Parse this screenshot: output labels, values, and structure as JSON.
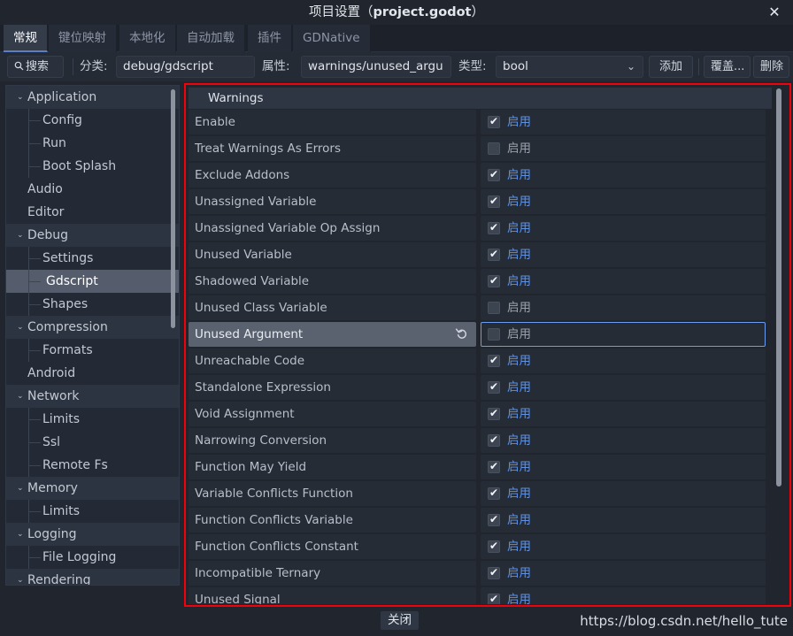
{
  "window": {
    "title_prefix": "项目设置（",
    "title_file": "project.godot",
    "title_suffix": "）",
    "close_icon": "✕"
  },
  "tabs": [
    {
      "label": "常规",
      "active": true
    },
    {
      "label": "键位映射",
      "active": false
    },
    {
      "label": "本地化",
      "active": false
    },
    {
      "label": "自动加载",
      "active": false
    },
    {
      "label": "插件",
      "active": false
    },
    {
      "label": "GDNative",
      "active": false
    }
  ],
  "toolbar": {
    "search_label": "搜索",
    "search_icon": "search-icon",
    "category_label": "分类:",
    "category_value": "debug/gdscript",
    "property_label": "属性:",
    "property_value": "warnings/unused_argu",
    "type_label": "类型:",
    "type_value": "bool",
    "type_chevron": "⌄",
    "add_label": "添加",
    "override_label": "覆盖...",
    "delete_label": "删除"
  },
  "sidebar": {
    "items": [
      {
        "label": "Application",
        "level": 0,
        "arrow": "⌄",
        "group": true,
        "selected": false,
        "guide": false
      },
      {
        "label": "Config",
        "level": 1,
        "arrow": "",
        "group": false,
        "selected": false,
        "guide": true
      },
      {
        "label": "Run",
        "level": 1,
        "arrow": "",
        "group": false,
        "selected": false,
        "guide": true
      },
      {
        "label": "Boot Splash",
        "level": 1,
        "arrow": "",
        "group": false,
        "selected": false,
        "guide": true
      },
      {
        "label": "Audio",
        "level": 0,
        "arrow": "",
        "group": false,
        "selected": false,
        "guide": false
      },
      {
        "label": "Editor",
        "level": 0,
        "arrow": "",
        "group": false,
        "selected": false,
        "guide": false
      },
      {
        "label": "Debug",
        "level": 0,
        "arrow": "⌄",
        "group": true,
        "selected": false,
        "guide": false
      },
      {
        "label": "Settings",
        "level": 1,
        "arrow": "",
        "group": false,
        "selected": false,
        "guide": true
      },
      {
        "label": "Gdscript",
        "level": 1,
        "arrow": "",
        "group": false,
        "selected": true,
        "guide": true
      },
      {
        "label": "Shapes",
        "level": 1,
        "arrow": "",
        "group": false,
        "selected": false,
        "guide": true
      },
      {
        "label": "Compression",
        "level": 0,
        "arrow": "⌄",
        "group": true,
        "selected": false,
        "guide": false
      },
      {
        "label": "Formats",
        "level": 1,
        "arrow": "",
        "group": false,
        "selected": false,
        "guide": true
      },
      {
        "label": "Android",
        "level": 0,
        "arrow": "",
        "group": false,
        "selected": false,
        "guide": false
      },
      {
        "label": "Network",
        "level": 0,
        "arrow": "⌄",
        "group": true,
        "selected": false,
        "guide": false
      },
      {
        "label": "Limits",
        "level": 1,
        "arrow": "",
        "group": false,
        "selected": false,
        "guide": true
      },
      {
        "label": "Ssl",
        "level": 1,
        "arrow": "",
        "group": false,
        "selected": false,
        "guide": true
      },
      {
        "label": "Remote Fs",
        "level": 1,
        "arrow": "",
        "group": false,
        "selected": false,
        "guide": true
      },
      {
        "label": "Memory",
        "level": 0,
        "arrow": "⌄",
        "group": true,
        "selected": false,
        "guide": false
      },
      {
        "label": "Limits",
        "level": 1,
        "arrow": "",
        "group": false,
        "selected": false,
        "guide": true
      },
      {
        "label": "Logging",
        "level": 0,
        "arrow": "⌄",
        "group": true,
        "selected": false,
        "guide": false
      },
      {
        "label": "File Logging",
        "level": 1,
        "arrow": "",
        "group": false,
        "selected": false,
        "guide": true
      },
      {
        "label": "Rendering",
        "level": 0,
        "arrow": "⌄",
        "group": true,
        "selected": false,
        "guide": false
      }
    ]
  },
  "properties": {
    "section_title": "Warnings",
    "enabled_text": "启用",
    "revert_icon": "revert-icon",
    "rows": [
      {
        "label": "Enable",
        "checked": true,
        "selected": false
      },
      {
        "label": "Treat Warnings As Errors",
        "checked": false,
        "selected": false
      },
      {
        "label": "Exclude Addons",
        "checked": true,
        "selected": false
      },
      {
        "label": "Unassigned Variable",
        "checked": true,
        "selected": false
      },
      {
        "label": "Unassigned Variable Op Assign",
        "checked": true,
        "selected": false
      },
      {
        "label": "Unused Variable",
        "checked": true,
        "selected": false
      },
      {
        "label": "Shadowed Variable",
        "checked": true,
        "selected": false
      },
      {
        "label": "Unused Class Variable",
        "checked": false,
        "selected": false
      },
      {
        "label": "Unused Argument",
        "checked": false,
        "selected": true
      },
      {
        "label": "Unreachable Code",
        "checked": true,
        "selected": false
      },
      {
        "label": "Standalone Expression",
        "checked": true,
        "selected": false
      },
      {
        "label": "Void Assignment",
        "checked": true,
        "selected": false
      },
      {
        "label": "Narrowing Conversion",
        "checked": true,
        "selected": false
      },
      {
        "label": "Function May Yield",
        "checked": true,
        "selected": false
      },
      {
        "label": "Variable Conflicts Function",
        "checked": true,
        "selected": false
      },
      {
        "label": "Function Conflicts Variable",
        "checked": true,
        "selected": false
      },
      {
        "label": "Function Conflicts Constant",
        "checked": true,
        "selected": false
      },
      {
        "label": "Incompatible Ternary",
        "checked": true,
        "selected": false
      },
      {
        "label": "Unused Signal",
        "checked": true,
        "selected": false
      }
    ]
  },
  "footer": {
    "close_label": "关闭",
    "watermark": "https://blog.csdn.net/hello_tute"
  },
  "colors": {
    "accent_blue": "#5b91e8",
    "annotation_red": "#f4000a",
    "selection": "#5a6270",
    "panel_bg": "#21262e"
  }
}
